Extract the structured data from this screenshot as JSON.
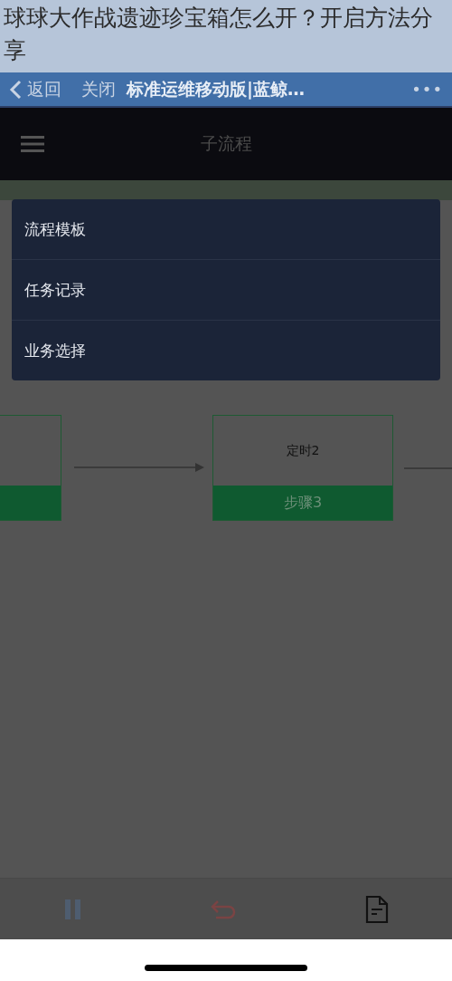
{
  "caption": "球球大作战遗迹珍宝箱怎么开？开启方法分享",
  "nav_bar": {
    "back": "返回",
    "close": "关闭",
    "title": "标准运维移动版|蓝鲸…",
    "more": "•••"
  },
  "header": {
    "title": "子流程"
  },
  "menu": {
    "items": [
      "流程模板",
      "任务记录",
      "业务选择"
    ]
  },
  "flow": {
    "nodes": [
      {
        "kind": "cut"
      },
      {
        "kind": "step",
        "name": "定时2",
        "step": "步骤3"
      }
    ]
  }
}
